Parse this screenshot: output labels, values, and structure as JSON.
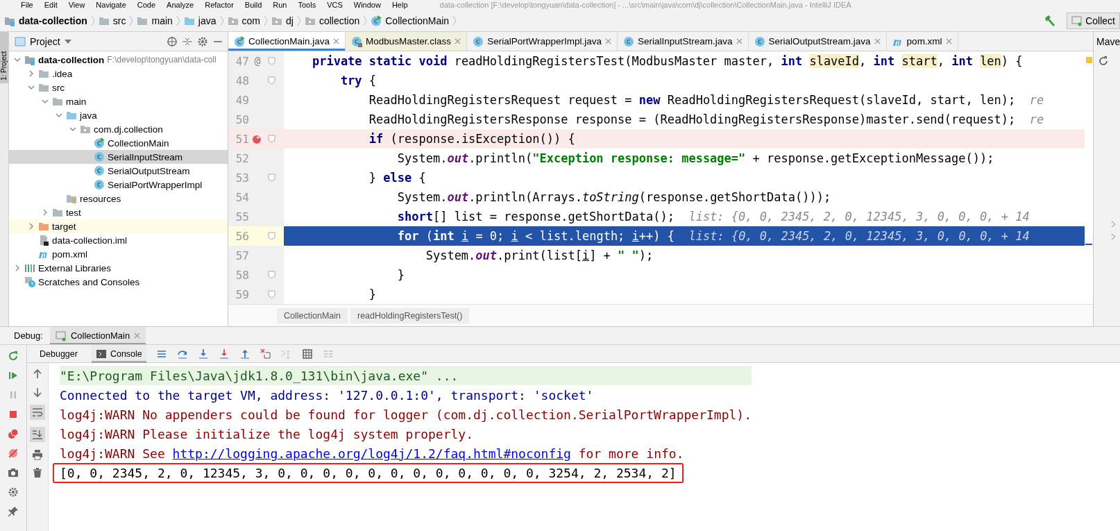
{
  "menu": [
    "File",
    "Edit",
    "View",
    "Navigate",
    "Code",
    "Analyze",
    "Refactor",
    "Build",
    "Run",
    "Tools",
    "VCS",
    "Window",
    "Help"
  ],
  "window": {
    "title": "data-collection [F:\\develop\\tongyuan\\data-collection] - ...\\src\\main\\java\\com\\dj\\collection\\CollectionMain.java - IntelliJ IDEA"
  },
  "navbar": {
    "items": [
      {
        "label": "data-collection",
        "kind": "module"
      },
      {
        "label": "src",
        "kind": "folder"
      },
      {
        "label": "main",
        "kind": "folder"
      },
      {
        "label": "java",
        "kind": "source-folder"
      },
      {
        "label": "com",
        "kind": "package"
      },
      {
        "label": "dj",
        "kind": "package"
      },
      {
        "label": "collection",
        "kind": "package"
      },
      {
        "label": "CollectionMain",
        "kind": "class-run"
      }
    ],
    "run_config": "Collect"
  },
  "left_stripe": {
    "label": "1: Project"
  },
  "project": {
    "title": "Project",
    "tree": [
      {
        "label": "data-collection",
        "note": "F:\\develop\\tongyuan\\data-coll",
        "kind": "module",
        "expanded": true,
        "selected": false,
        "highlighted": false,
        "children": [
          {
            "label": ".idea",
            "kind": "folder",
            "expanded": false,
            "selected": false,
            "highlighted": false
          },
          {
            "label": "src",
            "kind": "folder",
            "expanded": true,
            "selected": false,
            "highlighted": false,
            "children": [
              {
                "label": "main",
                "kind": "folder",
                "expanded": true,
                "selected": false,
                "highlighted": false,
                "children": [
                  {
                    "label": "java",
                    "kind": "source-folder",
                    "expanded": true,
                    "selected": false,
                    "highlighted": false,
                    "children": [
                      {
                        "label": "com.dj.collection",
                        "kind": "package",
                        "expanded": true,
                        "selected": false,
                        "highlighted": false,
                        "children": [
                          {
                            "label": "CollectionMain",
                            "kind": "class-run",
                            "selected": false,
                            "highlighted": false
                          },
                          {
                            "label": "SerialInputStream",
                            "kind": "class",
                            "selected": true,
                            "highlighted": false
                          },
                          {
                            "label": "SerialOutputStream",
                            "kind": "class",
                            "selected": false,
                            "highlighted": false
                          },
                          {
                            "label": "SerialPortWrapperImpl",
                            "kind": "class",
                            "selected": false,
                            "highlighted": false
                          }
                        ]
                      }
                    ]
                  },
                  {
                    "label": "resources",
                    "kind": "resources",
                    "selected": false,
                    "highlighted": false
                  }
                ]
              },
              {
                "label": "test",
                "kind": "folder",
                "expanded": false,
                "selected": false,
                "highlighted": false
              }
            ]
          },
          {
            "label": "target",
            "kind": "excluded-folder",
            "expanded": false,
            "selected": false,
            "highlighted": true
          },
          {
            "label": "data-collection.iml",
            "kind": "iml",
            "selected": false,
            "highlighted": false
          },
          {
            "label": "pom.xml",
            "kind": "maven",
            "selected": false,
            "highlighted": false
          }
        ]
      },
      {
        "label": "External Libraries",
        "kind": "libraries",
        "expanded": false,
        "selected": false,
        "highlighted": false
      },
      {
        "label": "Scratches and Consoles",
        "kind": "scratches",
        "selected": false,
        "highlighted": false
      }
    ]
  },
  "tabs": [
    {
      "label": "CollectionMain.java",
      "kind": "class-run",
      "selected": true
    },
    {
      "label": "ModbusMaster.class",
      "kind": "class-lib",
      "selected": false
    },
    {
      "label": "SerialPortWrapperImpl.java",
      "kind": "class",
      "selected": false
    },
    {
      "label": "SerialInputStream.java",
      "kind": "class",
      "selected": false
    },
    {
      "label": "SerialOutputStream.java",
      "kind": "class",
      "selected": false
    },
    {
      "label": "pom.xml",
      "kind": "maven",
      "selected": false
    }
  ],
  "editor": {
    "lines": [
      {
        "number": "47",
        "gutter_mark": "@",
        "fold": true,
        "breakpoint": false,
        "current": false,
        "tokens": [
          {
            "kind": "keyword",
            "text": "    private static void"
          },
          {
            "kind": "plain",
            "text": " readHoldingRegistersTest(ModbusMaster master, "
          },
          {
            "kind": "keyword",
            "text": "int "
          },
          {
            "kind": "param",
            "text": "slaveId"
          },
          {
            "kind": "plain",
            "text": ", "
          },
          {
            "kind": "keyword",
            "text": "int "
          },
          {
            "kind": "param",
            "text": "start"
          },
          {
            "kind": "plain",
            "text": ", "
          },
          {
            "kind": "keyword",
            "text": "int "
          },
          {
            "kind": "param",
            "text": "len"
          },
          {
            "kind": "plain",
            "text": ") {"
          }
        ]
      },
      {
        "number": "48",
        "fold": true,
        "breakpoint": false,
        "current": false,
        "tokens": [
          {
            "kind": "keyword",
            "text": "        try"
          },
          {
            "kind": "plain",
            "text": " {"
          }
        ]
      },
      {
        "number": "49",
        "fold": false,
        "breakpoint": false,
        "current": false,
        "tokens": [
          {
            "kind": "plain",
            "text": "            ReadHoldingRegistersRequest request = "
          },
          {
            "kind": "keyword",
            "text": "new"
          },
          {
            "kind": "plain",
            "text": " ReadHoldingRegistersRequest(slaveId, start, len);"
          },
          {
            "kind": "hint",
            "text": "re"
          }
        ]
      },
      {
        "number": "50",
        "fold": false,
        "breakpoint": false,
        "current": false,
        "tokens": [
          {
            "kind": "plain",
            "text": "            ReadHoldingRegistersResponse response = (ReadHoldingRegistersResponse)master.send(request);"
          },
          {
            "kind": "hint",
            "text": "re"
          }
        ]
      },
      {
        "number": "51",
        "fold": true,
        "breakpoint": true,
        "current": false,
        "tokens": [
          {
            "kind": "keyword",
            "text": "            if"
          },
          {
            "kind": "plain",
            "text": " (response.isException()) {"
          }
        ]
      },
      {
        "number": "52",
        "fold": false,
        "breakpoint": false,
        "current": false,
        "tokens": [
          {
            "kind": "plain",
            "text": "                System."
          },
          {
            "kind": "field",
            "text": "out"
          },
          {
            "kind": "plain",
            "text": ".println("
          },
          {
            "kind": "string",
            "text": "\"Exception response: message=\""
          },
          {
            "kind": "plain",
            "text": " + response.getExceptionMessage());"
          }
        ]
      },
      {
        "number": "53",
        "fold": true,
        "breakpoint": false,
        "current": false,
        "tokens": [
          {
            "kind": "plain",
            "text": "            } "
          },
          {
            "kind": "keyword",
            "text": "else"
          },
          {
            "kind": "plain",
            "text": " {"
          }
        ]
      },
      {
        "number": "54",
        "fold": false,
        "breakpoint": false,
        "current": false,
        "tokens": [
          {
            "kind": "plain",
            "text": "                System."
          },
          {
            "kind": "field",
            "text": "out"
          },
          {
            "kind": "plain",
            "text": ".println(Arrays."
          },
          {
            "kind": "static",
            "text": "toString"
          },
          {
            "kind": "plain",
            "text": "(response.getShortData()));"
          }
        ]
      },
      {
        "number": "55",
        "fold": false,
        "breakpoint": false,
        "current": false,
        "tokens": [
          {
            "kind": "keyword",
            "text": "                short"
          },
          {
            "kind": "plain",
            "text": "[] list = response.getShortData();"
          },
          {
            "kind": "hint",
            "text": "list: {0, 0, 2345, 2, 0, 12345, 3, 0, 0, 0, + 14"
          }
        ]
      },
      {
        "number": "56",
        "fold": true,
        "breakpoint": false,
        "current": true,
        "tokens": [
          {
            "kind": "keyword",
            "text": "                for"
          },
          {
            "kind": "plain",
            "text": " ("
          },
          {
            "kind": "keyword",
            "text": "int "
          },
          {
            "kind": "reassigned",
            "text": "i"
          },
          {
            "kind": "plain",
            "text": " = 0; "
          },
          {
            "kind": "reassigned",
            "text": "i"
          },
          {
            "kind": "plain",
            "text": " < list.length; "
          },
          {
            "kind": "reassigned",
            "text": "i"
          },
          {
            "kind": "plain",
            "text": "++) {"
          },
          {
            "kind": "hint",
            "text": "list: {0, 0, 2345, 2, 0, 12345, 3, 0, 0, 0, + 14"
          }
        ]
      },
      {
        "number": "57",
        "fold": false,
        "breakpoint": false,
        "current": false,
        "tokens": [
          {
            "kind": "plain",
            "text": "                    System."
          },
          {
            "kind": "field",
            "text": "out"
          },
          {
            "kind": "plain",
            "text": ".print(list["
          },
          {
            "kind": "reassigned",
            "text": "i"
          },
          {
            "kind": "plain",
            "text": "] + "
          },
          {
            "kind": "string",
            "text": "\" \""
          },
          {
            "kind": "plain",
            "text": ");"
          }
        ]
      },
      {
        "number": "58",
        "fold": true,
        "breakpoint": false,
        "current": false,
        "tokens": [
          {
            "kind": "plain",
            "text": "                }"
          }
        ]
      },
      {
        "number": "59",
        "fold": true,
        "breakpoint": false,
        "current": false,
        "tokens": [
          {
            "kind": "plain",
            "text": "            }"
          }
        ]
      }
    ],
    "breadcrumbs": [
      "CollectionMain",
      "readHoldingRegistersTest()"
    ]
  },
  "maven": {
    "title": "Mave"
  },
  "debug": {
    "label": "Debug:",
    "session": "CollectionMain",
    "tabs": [
      {
        "label": "Debugger",
        "selected": false
      },
      {
        "label": "Console",
        "selected": true
      }
    ],
    "console": [
      {
        "kind": "command",
        "boxed": false,
        "text": "\"E:\\Program Files\\Java\\jdk1.8.0_131\\bin\\java.exe\" ..."
      },
      {
        "kind": "info",
        "boxed": false,
        "text": "Connected to the target VM, address: '127.0.0.1:0', transport: 'socket'"
      },
      {
        "kind": "warn",
        "boxed": false,
        "text": "log4j:WARN No appenders could be found for logger (com.dj.collection.SerialPortWrapperImpl)."
      },
      {
        "kind": "warn",
        "boxed": false,
        "text": "log4j:WARN Please initialize the log4j system properly."
      },
      {
        "kind": "warn",
        "boxed": false,
        "text": "log4j:WARN See ",
        "link": "http://logging.apache.org/log4j/1.2/faq.html#noconfig",
        "after": " for more info."
      },
      {
        "kind": "output",
        "boxed": true,
        "text": "[0, 0, 2345, 2, 0, 12345, 3, 0, 0, 0, 0, 0, 0, 0, 0, 0, 0, 0, 0, 3254, 2, 2534, 2]"
      }
    ]
  }
}
